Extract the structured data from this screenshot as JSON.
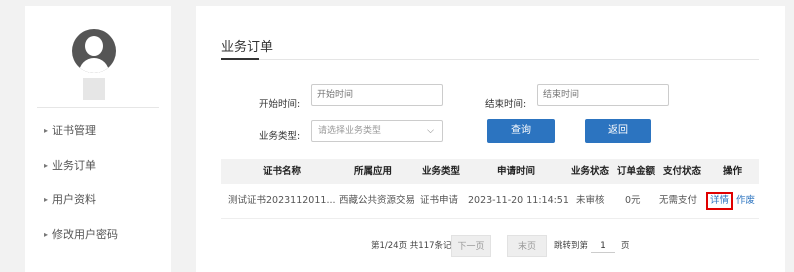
{
  "sidebar": {
    "items": [
      {
        "label": "证书管理"
      },
      {
        "label": "业务订单"
      },
      {
        "label": "用户资料"
      },
      {
        "label": "修改用户密码"
      }
    ]
  },
  "main": {
    "title": "业务订单",
    "filters": {
      "start_label": "开始时间:",
      "start_placeholder": "开始时间",
      "end_label": "结束时间:",
      "end_placeholder": "结束时间",
      "type_label": "业务类型:",
      "type_placeholder": "请选择业务类型",
      "query_button": "查询",
      "back_button": "返回"
    },
    "table": {
      "headers": [
        "证书名称",
        "所属应用",
        "业务类型",
        "申请时间",
        "业务状态",
        "订单金额",
        "支付状态",
        "操作"
      ],
      "rows": [
        {
          "cert_name": "测试证书2023112011...",
          "app": "西藏公共资源交易",
          "type": "证书申请",
          "time": "2023-11-20 11:14:51",
          "status": "未审核",
          "amount": "0元",
          "pay_status": "无需支付",
          "action_detail": "详情",
          "action_void": "作废"
        }
      ]
    },
    "pagination": {
      "summary": "第1/24页 共117条记录",
      "next": "下一页",
      "last": "末页",
      "jump_label": "跳转到第",
      "jump_value": "1",
      "page_suffix": "页"
    }
  },
  "colors": {
    "accent": "#2c74c0",
    "highlight_border": "#e00000"
  }
}
